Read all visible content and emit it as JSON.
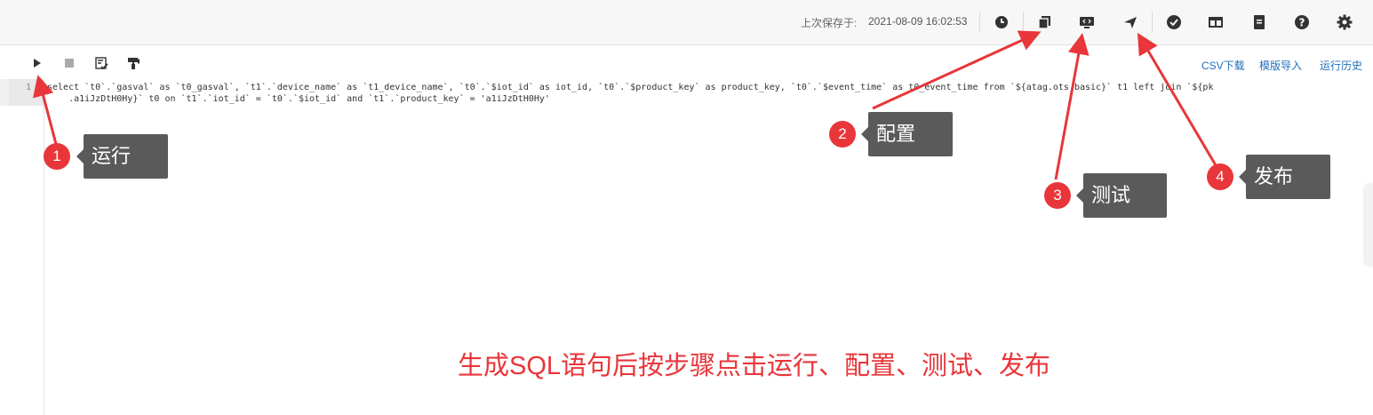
{
  "header": {
    "save_label": "上次保存于:",
    "save_time": "2021-08-09 16:02:53",
    "icons": [
      "history-icon",
      "config-icon",
      "test-icon",
      "publish-icon",
      "check-icon",
      "layout-icon",
      "doc-icon",
      "help-icon",
      "gear-icon"
    ]
  },
  "toolbar": {
    "links": {
      "csv": "CSV下载",
      "template": "模版导入",
      "history": "运行历史"
    }
  },
  "editor": {
    "line_number": "1",
    "line1": "select `t0`.`gasval` as `t0_gasval`, `t1`.`device_name` as `t1_device_name`, `t0`.`$iot_id` as iot_id, `t0`.`$product_key` as product_key, `t0`.`$event_time` as t0_event_time from `${atag.ots.basic}` t1 left join `${pk",
    "line2": "    .a1iJzDtH0Hy}` t0 on `t1`.`iot_id` = `t0`.`$iot_id` and `t1`.`product_key` = 'a1iJzDtH0Hy'"
  },
  "annotations": {
    "steps": [
      {
        "num": "1",
        "label": "运行"
      },
      {
        "num": "2",
        "label": "配置"
      },
      {
        "num": "3",
        "label": "测试"
      },
      {
        "num": "4",
        "label": "发布"
      }
    ],
    "caption": "生成SQL语句后按步骤点击运行、配置、测试、发布",
    "color": "#e8363a"
  }
}
